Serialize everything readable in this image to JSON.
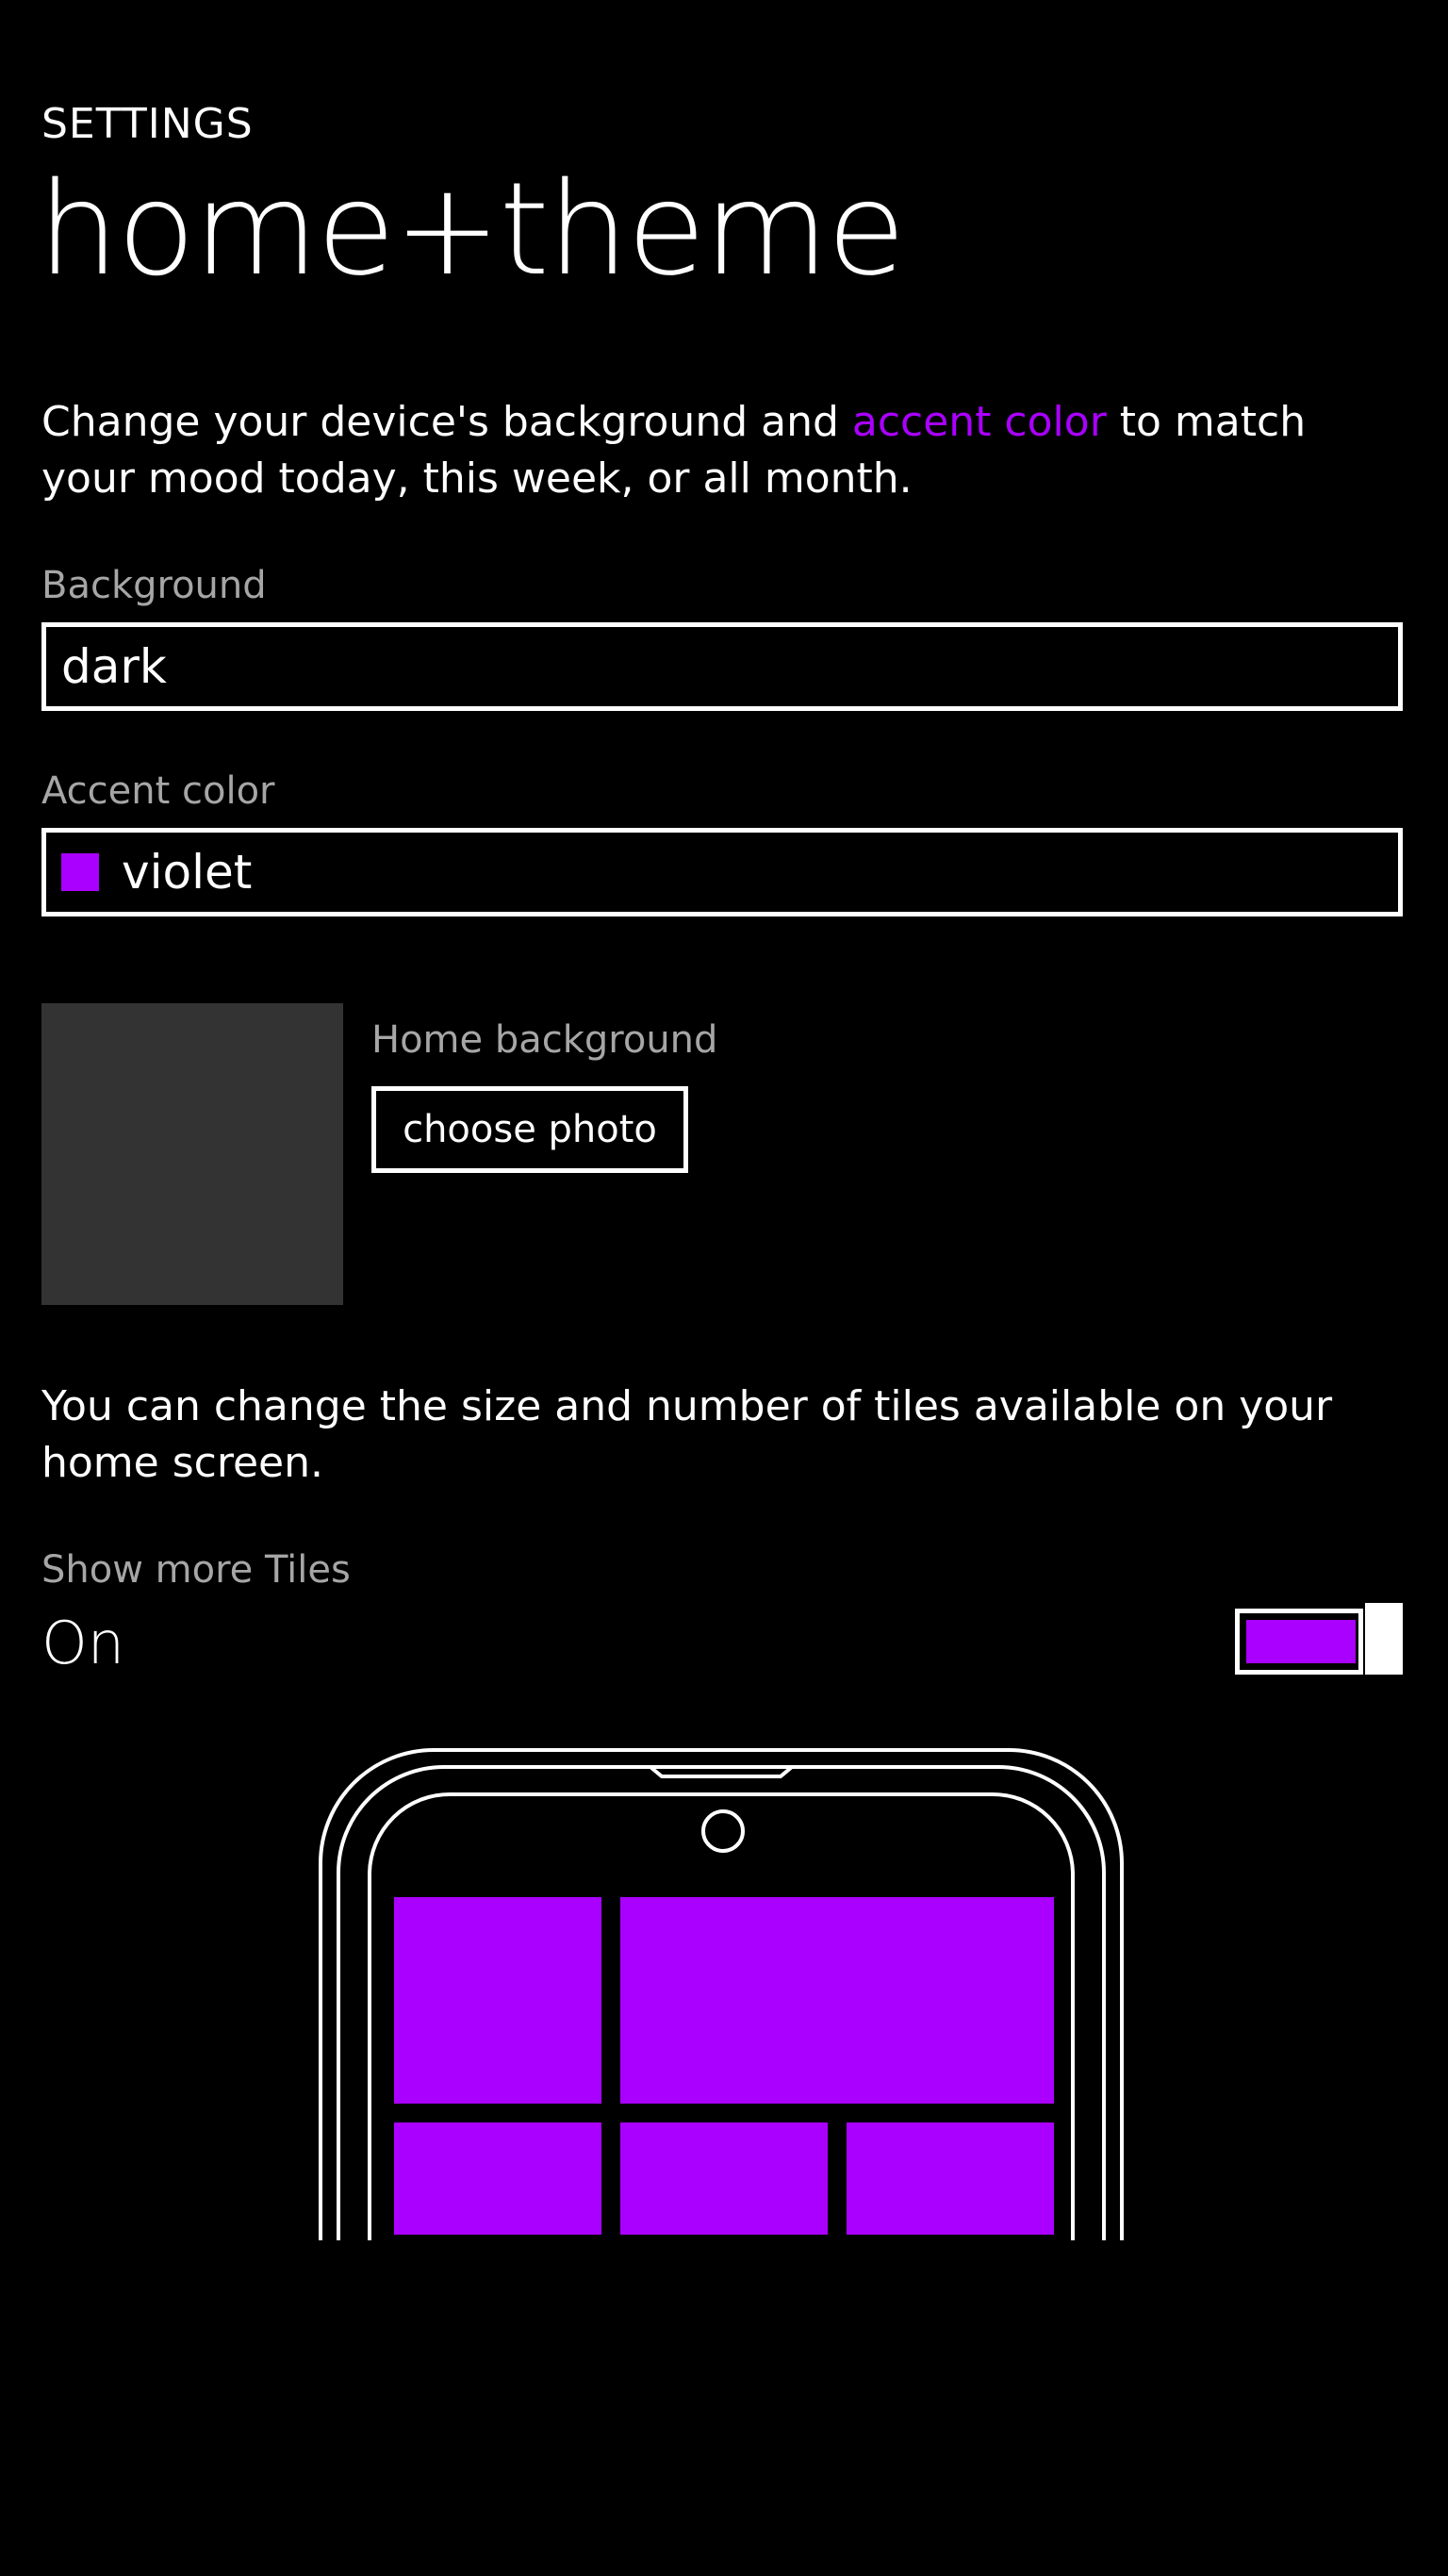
{
  "header": {
    "section": "SETTINGS",
    "title": "home+theme"
  },
  "intro": {
    "before": "Change your device's background and ",
    "link": "accent color",
    "after": " to match your mood today, this week, or all month."
  },
  "background_field": {
    "label": "Background",
    "value": "dark"
  },
  "accent_field": {
    "label": "Accent color",
    "value": "violet",
    "swatch_color": "#aa00ff"
  },
  "home_background": {
    "label": "Home background",
    "button_label": "choose photo"
  },
  "tiles": {
    "description": "You can change the size and number of tiles available on your home screen.",
    "toggle_label": "Show more Tiles",
    "toggle_state": "On",
    "toggle_on": true
  },
  "colors": {
    "accent": "#aa00ff",
    "background": "#000000",
    "label_gray": "#a6a6a6",
    "thumbnail": "#333333"
  },
  "icons": {
    "phone_preview": "phone-outline-with-tiles-icon"
  }
}
